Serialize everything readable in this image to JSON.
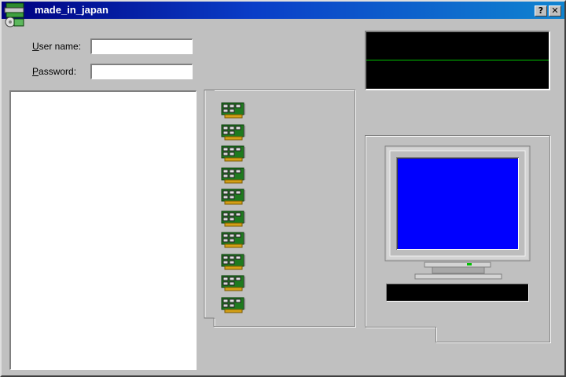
{
  "window": {
    "title": "made_in_japan",
    "help_button": "?",
    "close_button": "✕"
  },
  "login": {
    "username_label_accel": "U",
    "username_label_rest": "ser name:",
    "username_value": "",
    "password_label_accel": "P",
    "password_label_rest": "assword:",
    "password_value": ""
  },
  "adapters": {
    "icon": "network-card-icon",
    "count": 10
  },
  "oscilloscope": {
    "trace_color": "#00c000",
    "background": "#000000"
  },
  "monitor": {
    "screen_color": "#0000ff"
  },
  "colors": {
    "titlebar_start": "#000080",
    "titlebar_end": "#1084d0",
    "window_bg": "#c0c0c0"
  }
}
